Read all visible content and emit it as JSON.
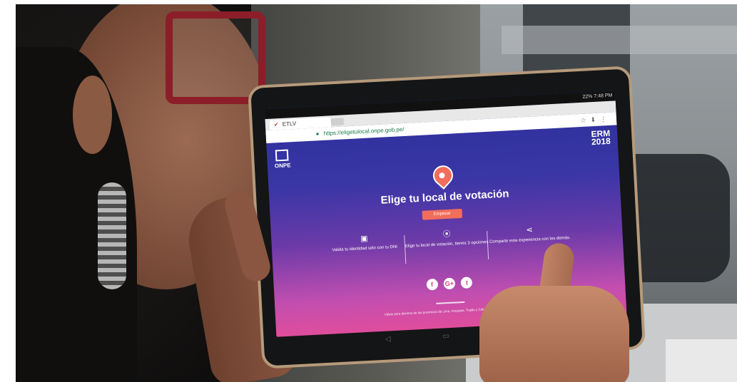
{
  "browser": {
    "tab_label": "ETLV",
    "url": "https://eligetulocal.onpe.gob.pe/",
    "status": "22% 7:48 PM"
  },
  "brand": {
    "logo_text": "ONPE",
    "event_line1": "ERM",
    "event_line2": "2018"
  },
  "hero": {
    "headline": "Elige tu local de votación",
    "cta_label": "Empezar"
  },
  "features": [
    {
      "icon": "id-card-icon",
      "text": "Valida tu identidad solo con tu DNI"
    },
    {
      "icon": "location-pin-icon",
      "text": "Elige tu local de votación, tienes 3 opciones."
    },
    {
      "icon": "share-icon",
      "text": "Comparte esta experiencia con los demás."
    }
  ],
  "social": [
    "f",
    "G+",
    "t"
  ],
  "footnote": "Válido para distritos de las provincias de Lima, Arequipa, Trujillo y Callao (con más de 1 local)"
}
